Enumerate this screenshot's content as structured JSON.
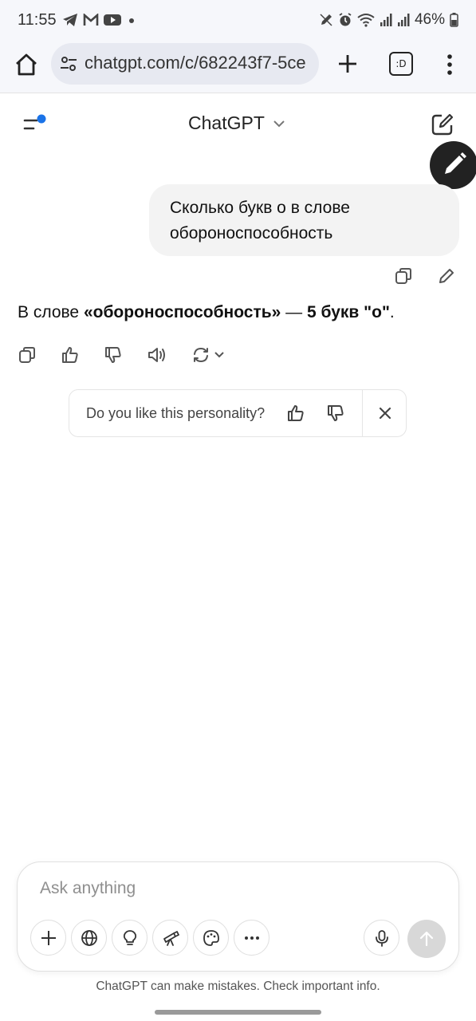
{
  "status_bar": {
    "time": "11:55",
    "battery": "46%",
    "left_icons": [
      "telegram-icon",
      "gmail-icon",
      "youtube-icon",
      "dot-icon"
    ],
    "right_icons": [
      "pen-icon",
      "alarm-icon",
      "wifi-icon",
      "signal-icon",
      "signal-icon",
      "battery-icon"
    ]
  },
  "browser": {
    "url": "chatgpt.com/c/682243f7-5ce",
    "tab_count": ":D"
  },
  "header": {
    "title": "ChatGPT"
  },
  "conversation": {
    "user_message": "Сколько букв о в слове обороноспособность",
    "assistant": {
      "prefix": "В слове ",
      "bold_word": "«обороноспособность»",
      "middle": " — ",
      "bold_count": "5 букв",
      "space": " ",
      "bold_letter": "\"о\"",
      "suffix": "."
    }
  },
  "feedback": {
    "question": "Do you like this personality?"
  },
  "composer": {
    "placeholder": "Ask anything"
  },
  "footer": {
    "disclaimer": "ChatGPT can make mistakes. Check important info."
  },
  "colors": {
    "notification_dot": "#1a73e8",
    "bubble_bg": "#f3f3f3",
    "send_disabled": "#d8d8d8"
  }
}
